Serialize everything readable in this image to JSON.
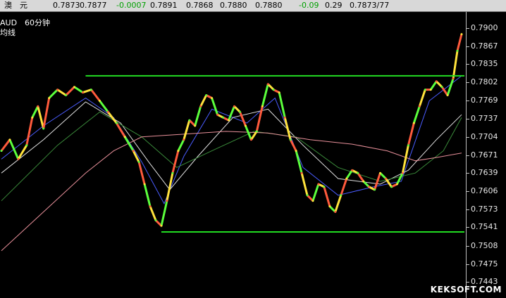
{
  "quote_bar": {
    "name": "澳　元",
    "open": "0.7873",
    "close": "0.7877",
    "change": "-0.0007",
    "high": "0.7891",
    "low": "0.7868",
    "bid": "0.7880",
    "ask": "0.7880",
    "change_pct": "-0.09",
    "value": "0.29",
    "range": "0.7873/77"
  },
  "chart_labels": {
    "symbol_period": "AUD　60分钟",
    "line_type": "均线"
  },
  "chart_data": {
    "type": "line",
    "title": "",
    "y_ticks": [
      "0.7900",
      "0.7867",
      "0.7835",
      "0.7802",
      "0.7769",
      "0.7737",
      "0.7704",
      "0.7671",
      "0.7639",
      "0.7606",
      "0.7573",
      "0.7541",
      "0.7508",
      "0.7475",
      "0.7443"
    ],
    "ylim": [
      0.7415,
      0.793
    ],
    "xlim": [
      0,
      330
    ],
    "support_line": {
      "y": 0.7534,
      "x_start": 114,
      "x_end": 330
    },
    "resistance_line": {
      "y": 0.7815,
      "x_start": 60,
      "x_end": 330
    },
    "price_series": [
      [
        0,
        0.768
      ],
      [
        6,
        0.77
      ],
      [
        12,
        0.7665
      ],
      [
        18,
        0.769
      ],
      [
        22,
        0.774
      ],
      [
        26,
        0.776
      ],
      [
        30,
        0.772
      ],
      [
        34,
        0.7775
      ],
      [
        40,
        0.779
      ],
      [
        46,
        0.778
      ],
      [
        52,
        0.7795
      ],
      [
        58,
        0.7785
      ],
      [
        64,
        0.779
      ],
      [
        70,
        0.777
      ],
      [
        76,
        0.775
      ],
      [
        82,
        0.773
      ],
      [
        88,
        0.7705
      ],
      [
        94,
        0.768
      ],
      [
        98,
        0.766
      ],
      [
        102,
        0.762
      ],
      [
        106,
        0.758
      ],
      [
        110,
        0.7555
      ],
      [
        114,
        0.7545
      ],
      [
        118,
        0.759
      ],
      [
        122,
        0.764
      ],
      [
        126,
        0.768
      ],
      [
        130,
        0.77
      ],
      [
        134,
        0.7735
      ],
      [
        138,
        0.7725
      ],
      [
        142,
        0.776
      ],
      [
        146,
        0.778
      ],
      [
        150,
        0.7775
      ],
      [
        154,
        0.7745
      ],
      [
        158,
        0.774
      ],
      [
        162,
        0.7735
      ],
      [
        166,
        0.776
      ],
      [
        170,
        0.775
      ],
      [
        174,
        0.7725
      ],
      [
        178,
        0.77
      ],
      [
        182,
        0.7715
      ],
      [
        186,
        0.776
      ],
      [
        190,
        0.78
      ],
      [
        194,
        0.779
      ],
      [
        198,
        0.7785
      ],
      [
        202,
        0.774
      ],
      [
        206,
        0.77
      ],
      [
        210,
        0.768
      ],
      [
        214,
        0.764
      ],
      [
        218,
        0.76
      ],
      [
        222,
        0.759
      ],
      [
        226,
        0.762
      ],
      [
        230,
        0.7615
      ],
      [
        234,
        0.758
      ],
      [
        238,
        0.757
      ],
      [
        242,
        0.76
      ],
      [
        246,
        0.763
      ],
      [
        250,
        0.7645
      ],
      [
        254,
        0.764
      ],
      [
        258,
        0.7625
      ],
      [
        262,
        0.7615
      ],
      [
        266,
        0.761
      ],
      [
        270,
        0.764
      ],
      [
        274,
        0.763
      ],
      [
        278,
        0.7615
      ],
      [
        282,
        0.762
      ],
      [
        286,
        0.764
      ],
      [
        290,
        0.769
      ],
      [
        294,
        0.773
      ],
      [
        298,
        0.776
      ],
      [
        302,
        0.779
      ],
      [
        306,
        0.779
      ],
      [
        310,
        0.7805
      ],
      [
        314,
        0.7795
      ],
      [
        318,
        0.778
      ],
      [
        322,
        0.781
      ],
      [
        325,
        0.786
      ],
      [
        328,
        0.789
      ]
    ],
    "ma_series": [
      {
        "color": "#4a5cff",
        "points": [
          [
            0,
            0.7665
          ],
          [
            30,
            0.7725
          ],
          [
            60,
            0.7775
          ],
          [
            80,
            0.774
          ],
          [
            100,
            0.766
          ],
          [
            116,
            0.7585
          ],
          [
            130,
            0.767
          ],
          [
            150,
            0.7755
          ],
          [
            175,
            0.773
          ],
          [
            195,
            0.7775
          ],
          [
            215,
            0.765
          ],
          [
            240,
            0.76
          ],
          [
            265,
            0.7615
          ],
          [
            285,
            0.7625
          ],
          [
            305,
            0.777
          ],
          [
            328,
            0.7815
          ]
        ]
      },
      {
        "color": "#e0e0e0",
        "points": [
          [
            0,
            0.764
          ],
          [
            30,
            0.77
          ],
          [
            60,
            0.7768
          ],
          [
            85,
            0.773
          ],
          [
            105,
            0.766
          ],
          [
            120,
            0.761
          ],
          [
            140,
            0.767
          ],
          [
            165,
            0.774
          ],
          [
            190,
            0.7755
          ],
          [
            215,
            0.769
          ],
          [
            240,
            0.763
          ],
          [
            270,
            0.762
          ],
          [
            290,
            0.7645
          ],
          [
            310,
            0.77
          ],
          [
            328,
            0.7745
          ]
        ]
      },
      {
        "color": "#3a8a3a",
        "points": [
          [
            0,
            0.759
          ],
          [
            40,
            0.769
          ],
          [
            70,
            0.775
          ],
          [
            100,
            0.7705
          ],
          [
            125,
            0.765
          ],
          [
            150,
            0.768
          ],
          [
            180,
            0.7715
          ],
          [
            210,
            0.7705
          ],
          [
            240,
            0.765
          ],
          [
            270,
            0.7625
          ],
          [
            295,
            0.764
          ],
          [
            315,
            0.768
          ],
          [
            328,
            0.774
          ]
        ]
      },
      {
        "color": "#e8909a",
        "points": [
          [
            0,
            0.75
          ],
          [
            30,
            0.757
          ],
          [
            60,
            0.764
          ],
          [
            80,
            0.768
          ],
          [
            100,
            0.7705
          ],
          [
            130,
            0.771
          ],
          [
            160,
            0.7715
          ],
          [
            190,
            0.7712
          ],
          [
            220,
            0.77
          ],
          [
            250,
            0.7692
          ],
          [
            275,
            0.768
          ],
          [
            295,
            0.7662
          ],
          [
            310,
            0.7668
          ],
          [
            328,
            0.7676
          ]
        ]
      }
    ]
  },
  "watermark": "KEKSOFT.COM"
}
